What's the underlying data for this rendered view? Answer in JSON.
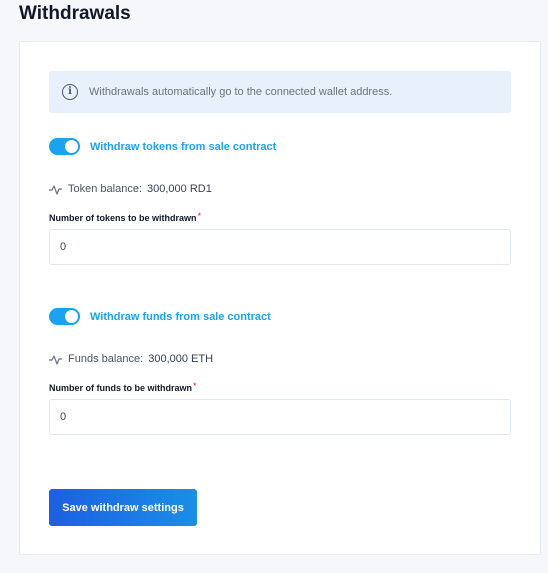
{
  "page": {
    "title": "Withdrawals"
  },
  "info": {
    "icon": "info-icon",
    "glyph": "i",
    "text": "Withdrawals automatically go to the connected wallet address."
  },
  "tokens": {
    "toggle_label": "Withdraw tokens from sale contract",
    "toggle_on": true,
    "balance_label": "Token balance:",
    "balance_value": "300,000 RD1",
    "field_label": "Number of tokens to be withdrawn",
    "required_mark": "*",
    "value": "0"
  },
  "funds": {
    "toggle_label": "Withdraw funds from sale contract",
    "toggle_on": true,
    "balance_label": "Funds balance:",
    "balance_value": "300,000 ETH",
    "field_label": "Number of funds to be withdrawn",
    "required_mark": "*",
    "value": "0"
  },
  "actions": {
    "save_label": "Save withdraw settings"
  },
  "colors": {
    "accent": "#1aa3f0",
    "button_start": "#1d5fe0",
    "button_end": "#1a8fe8",
    "info_bg": "#e8f0fb",
    "required": "#e11d48"
  }
}
